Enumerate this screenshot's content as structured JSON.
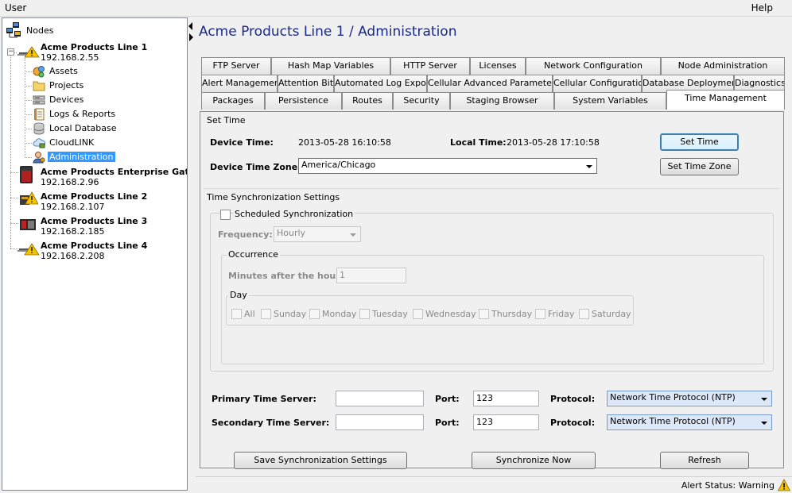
{
  "menubar": {
    "user": "User",
    "help": "Help"
  },
  "tree": {
    "root": "Nodes",
    "nodes": [
      {
        "name": "Acme Products Line 1",
        "ip": "192.168.2.55",
        "children": [
          {
            "label": "Assets",
            "icon": "assets-icon"
          },
          {
            "label": "Projects",
            "icon": "folder-icon"
          },
          {
            "label": "Devices",
            "icon": "devices-icon"
          },
          {
            "label": "Logs & Reports",
            "icon": "logs-icon"
          },
          {
            "label": "Local Database",
            "icon": "database-icon"
          },
          {
            "label": "CloudLINK",
            "icon": "cloud-icon"
          },
          {
            "label": "Administration",
            "icon": "admin-user-icon",
            "selected": true
          }
        ]
      },
      {
        "name": "Acme Products Enterprise Gatew",
        "ip": "192.168.2.96"
      },
      {
        "name": "Acme Products Line 2",
        "ip": "192.168.2.107"
      },
      {
        "name": "Acme Products Line 3",
        "ip": "192.168.2.185"
      },
      {
        "name": "Acme Products Line 4",
        "ip": "192.168.2.208"
      }
    ]
  },
  "content": {
    "title": "Acme Products Line 1 / Administration",
    "tabs_row1": [
      "FTP Server",
      "Hash Map Variables",
      "HTTP Server",
      "Licenses",
      "Network Configuration",
      "Node Administration"
    ],
    "tabs_row2": [
      "Alert Management",
      "Attention Bit",
      "Automated Log Export",
      "Cellular Advanced Parameters",
      "Cellular Configuration",
      "Database Deployment",
      "Diagnostics"
    ],
    "tabs_row3": [
      "Packages",
      "Persistence",
      "Routes",
      "Security",
      "Staging Browser",
      "System Variables",
      "Time Management"
    ],
    "active_tab": "Time Management"
  },
  "set_time": {
    "title": "Set Time",
    "device_time_label": "Device Time:",
    "device_time_value": "2013-05-28 16:10:58",
    "local_time_label": "Local Time:",
    "local_time_value": "2013-05-28 17:10:58",
    "device_tz_label": "Device Time Zone:",
    "device_tz_value": "America/Chicago",
    "set_time_button": "Set Time",
    "set_tz_button": "Set Time Zone"
  },
  "sync": {
    "title": "Time Synchronization Settings",
    "scheduled_label": "Scheduled Synchronization",
    "frequency_label": "Frequency:",
    "frequency_value": "Hourly",
    "occurrence_title": "Occurrence",
    "minutes_label": "Minutes after the hour:",
    "minutes_value": "1",
    "day_title": "Day",
    "days": [
      "All",
      "Sunday",
      "Monday",
      "Tuesday",
      "Wednesday",
      "Thursday",
      "Friday",
      "Saturday"
    ],
    "primary_label": "Primary Time Server:",
    "secondary_label": "Secondary Time Server:",
    "port_label": "Port:",
    "primary_port": "123",
    "secondary_port": "123",
    "protocol_label": "Protocol:",
    "primary_protocol": "Network Time Protocol (NTP)",
    "secondary_protocol": "Network Time Protocol (NTP)",
    "save_button": "Save Synchronization Settings",
    "sync_now_button": "Synchronize Now",
    "refresh_button": "Refresh"
  },
  "status": {
    "alert_status": "Alert Status: Warning"
  }
}
